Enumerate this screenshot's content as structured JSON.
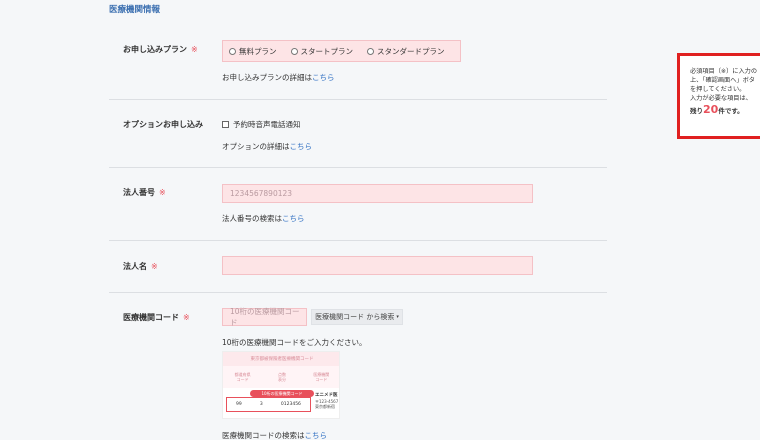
{
  "section": {
    "title": "医療機関情報"
  },
  "plan": {
    "label": "お申し込みプラン",
    "required_mark": "※",
    "options": [
      "無料プラン",
      "スタートプラン",
      "スタンダードプラン"
    ],
    "note_prefix": "お申し込みプランの詳細は",
    "note_link": "こちら"
  },
  "option": {
    "label": "オプションお申し込み",
    "checkbox_label": "予約時音声電話通知",
    "note_prefix": "オプションの詳細は",
    "note_link": "こちら"
  },
  "corp_number": {
    "label": "法人番号",
    "required_mark": "※",
    "placeholder": "1234567890123",
    "note_prefix": "法人番号の検索は",
    "note_link": "こちら"
  },
  "corp_name": {
    "label": "法人名",
    "required_mark": "※",
    "value": ""
  },
  "medical_code": {
    "label": "医療機関コード",
    "required_mark": "※",
    "placeholder": "10桁の医療機関コード",
    "search_button": "医療機関コード から検索",
    "search_caret": "▾",
    "instruction": "10桁の医療機関コードをご入力ください。",
    "card": {
      "header": "東京都被保険者医療機関コード",
      "cols": [
        "都道府県\nコード",
        "点数\n表分",
        "医療機関\nコード"
      ],
      "badge": "10桁の医療機関コード",
      "values": [
        "99",
        "3",
        "0123456"
      ],
      "side_title": "エニメド医",
      "side_line1": "〒123-4567",
      "side_line2": "東京都新宿"
    },
    "note_prefix": "医療機関コードの検索は",
    "note_link": "こちら"
  },
  "notice": {
    "line1": "必須項目（※）に入力の",
    "line2": "上、「確認画面へ」ボタ",
    "line3": "を押してください。",
    "line4": "入力が必要な項目は、",
    "remaining_prefix": "残り",
    "remaining_count": "20",
    "remaining_suffix": "件です。"
  },
  "colors": {
    "accent_blue": "#3b6fb0",
    "required_red": "#e8505b",
    "input_pink": "#fde4e6",
    "notice_border": "#e02020"
  }
}
